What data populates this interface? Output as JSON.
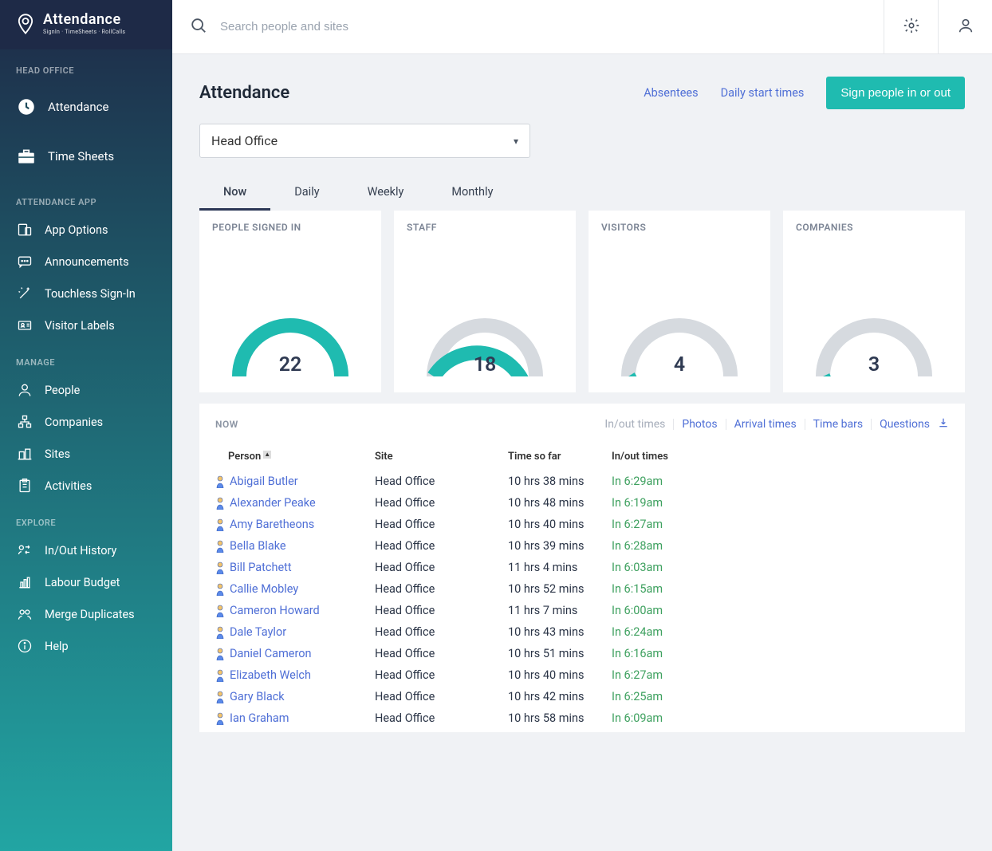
{
  "brand": {
    "name": "Attendance",
    "tagline": "SignIn · TimeSheets · RollCalls"
  },
  "search": {
    "placeholder": "Search people and sites"
  },
  "sidebar": {
    "section1_label": "HEAD OFFICE",
    "items1": [
      {
        "label": "Attendance"
      },
      {
        "label": "Time Sheets"
      }
    ],
    "section2_label": "ATTENDANCE APP",
    "items2": [
      {
        "label": "App Options"
      },
      {
        "label": "Announcements"
      },
      {
        "label": "Touchless Sign-In"
      },
      {
        "label": "Visitor Labels"
      }
    ],
    "section3_label": "MANAGE",
    "items3": [
      {
        "label": "People"
      },
      {
        "label": "Companies"
      },
      {
        "label": "Sites"
      },
      {
        "label": "Activities"
      }
    ],
    "section4_label": "EXPLORE",
    "items4": [
      {
        "label": "In/Out History"
      },
      {
        "label": "Labour Budget"
      },
      {
        "label": "Merge Duplicates"
      },
      {
        "label": "Help"
      }
    ]
  },
  "page": {
    "title": "Attendance",
    "link_absentees": "Absentees",
    "link_dailystart": "Daily start times",
    "primary_btn": "Sign people in or out",
    "site_selected": "Head Office"
  },
  "tabs": [
    "Now",
    "Daily",
    "Weekly",
    "Monthly"
  ],
  "cards": [
    {
      "label": "PEOPLE SIGNED IN",
      "value": "22",
      "pct": 1.0
    },
    {
      "label": "STAFF",
      "value": "18",
      "pct": 0.82
    },
    {
      "label": "VISITORS",
      "value": "4",
      "pct": 0.18
    },
    {
      "label": "COMPANIES",
      "value": "3",
      "pct": 0.14
    }
  ],
  "panel": {
    "label": "NOW",
    "link_inout": "In/out times",
    "link_photos": "Photos",
    "link_arrival": "Arrival times",
    "link_timebars": "Time bars",
    "link_questions": "Questions"
  },
  "table": {
    "headers": {
      "person": "Person",
      "site": "Site",
      "time": "Time so far",
      "inout": "In/out times"
    },
    "rows": [
      {
        "name": "Abigail Butler",
        "site": "Head Office",
        "time": "10 hrs 38 mins",
        "inout": "In 6:29am"
      },
      {
        "name": "Alexander Peake",
        "site": "Head Office",
        "time": "10 hrs 48 mins",
        "inout": "In 6:19am"
      },
      {
        "name": "Amy Baretheons",
        "site": "Head Office",
        "time": "10 hrs 40 mins",
        "inout": "In 6:27am"
      },
      {
        "name": "Bella Blake",
        "site": "Head Office",
        "time": "10 hrs 39 mins",
        "inout": "In 6:28am"
      },
      {
        "name": "Bill Patchett",
        "site": "Head Office",
        "time": "11 hrs 4 mins",
        "inout": "In 6:03am"
      },
      {
        "name": "Callie Mobley",
        "site": "Head Office",
        "time": "10 hrs 52 mins",
        "inout": "In 6:15am"
      },
      {
        "name": "Cameron Howard",
        "site": "Head Office",
        "time": "11 hrs 7 mins",
        "inout": "In 6:00am"
      },
      {
        "name": "Dale Taylor",
        "site": "Head Office",
        "time": "10 hrs 43 mins",
        "inout": "In 6:24am"
      },
      {
        "name": "Daniel Cameron",
        "site": "Head Office",
        "time": "10 hrs 51 mins",
        "inout": "In 6:16am"
      },
      {
        "name": "Elizabeth Welch",
        "site": "Head Office",
        "time": "10 hrs 40 mins",
        "inout": "In 6:27am"
      },
      {
        "name": "Gary Black",
        "site": "Head Office",
        "time": "10 hrs 42 mins",
        "inout": "In 6:25am"
      },
      {
        "name": "Ian Graham",
        "site": "Head Office",
        "time": "10 hrs 58 mins",
        "inout": "In 6:09am"
      }
    ]
  },
  "colors": {
    "accent": "#1fbbb0",
    "link": "#4f6fd6",
    "success": "#3fa160"
  }
}
